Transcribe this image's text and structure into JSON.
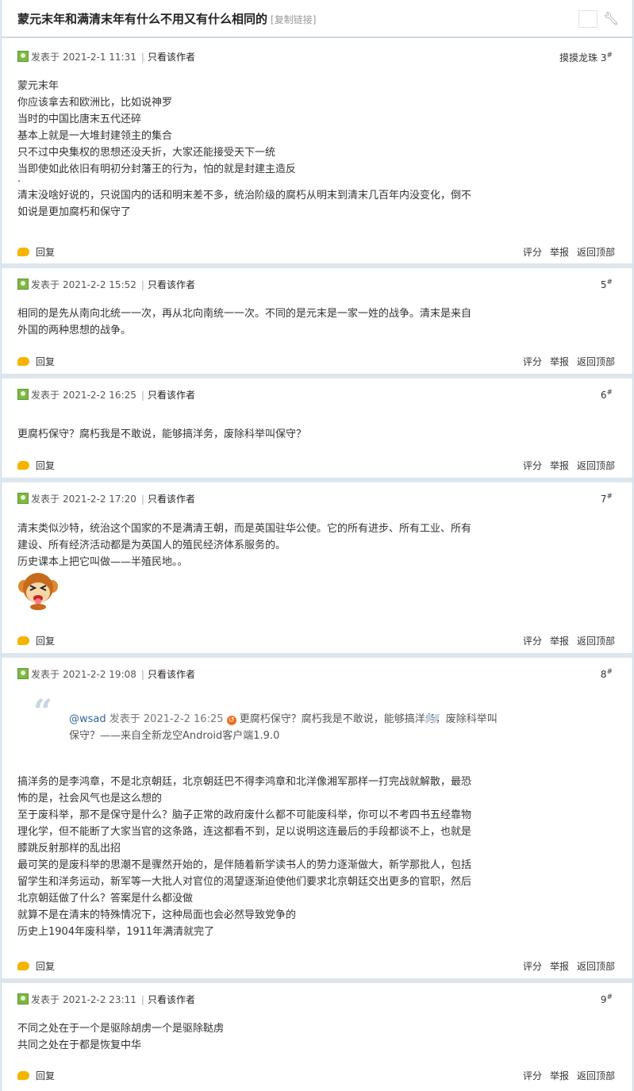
{
  "thread": {
    "title": "蒙元末年和满清末年有什么不用又有什么相同的",
    "copy_link": "[复制链接]"
  },
  "labels": {
    "posted_at": "发表于",
    "author_only": "只看该作者",
    "reply": "回复",
    "rate": "评分",
    "report": "举报",
    "back_top": "返回顶部",
    "floor_mark": "#"
  },
  "posts": [
    {
      "date": "2021-2-1 11:31",
      "floor": "摸摸龙珠 3",
      "lines": [
        "蒙元末年",
        "你应该拿去和欧洲比，比如说神罗",
        "当时的中国比唐末五代还碎",
        "基本上就是一大堆封建领主的集合",
        "只不过中央集权的思想还没夭折，大家还能接受天下一统",
        "当即使如此依旧有明初分封藩王的行为，怕的就是封建主造反",
        "·",
        "清末没啥好说的，只说国内的话和明末差不多，统治阶级的腐朽从明末到清末几百年内没变化，倒不",
        "如说是更加腐朽和保守了"
      ]
    },
    {
      "date": "2021-2-2 15:52",
      "floor": "5",
      "lines": [
        "相同的是先从南向北统一一次，再从北向南统一一次。不同的是元末是一家一姓的战争。清末是来自",
        "外国的两种思想的战争。"
      ]
    },
    {
      "date": "2021-2-2 16:25",
      "floor": "6",
      "lines": [
        "更腐朽保守？腐朽我是不敢说，能够搞洋务，废除科举叫保守？"
      ]
    },
    {
      "date": "2021-2-2 17:20",
      "floor": "7",
      "lines": [
        "清末类似沙特，统治这个国家的不是满清王朝，而是英国驻华公使。它的所有进步、所有工业、所有",
        "建设、所有经济活动都是为英国人的殖民经济体系服务的。",
        "历史课本上把它叫做——半殖民地。。"
      ],
      "emoji": "monkey-emoticon"
    },
    {
      "date": "2021-2-2 19:08",
      "floor": "8",
      "quote": {
        "user": "@wsad",
        "posted": "发表于 2021-2-2 16:25",
        "text_1": "更腐朽保守？腐朽我是不敢说，能够搞洋务，废除科举叫",
        "text_2": "保守？——来自全新龙空Android客户端1.9.0"
      },
      "lines": [
        "搞洋务的是李鸿章，不是北京朝廷，北京朝廷巴不得李鸿章和北洋像湘军那样一打完战就解散，最恐",
        "怖的是，社会风气也是这么想的",
        "至于废科举，那不是保守是什么？脑子正常的政府废什么都不可能废科举，你可以不考四书五经靠物",
        "理化学，但不能断了大家当官的这条路，连这都看不到，足以说明这连最后的手段都谈不上，也就是",
        "膝跳反射那样的乱出招",
        "最可笑的是废科举的思潮不是骤然开始的，是伴随着新学读书人的势力逐渐做大，新学那批人，包括",
        "留学生和洋务运动，新军等一大批人对官位的渴望逐渐迫使他们要求北京朝廷交出更多的官职，然后",
        "北京朝廷做了什么？答案是什么都没做",
        "就算不是在清末的特殊情况下，这种局面也会必然导致党争的",
        "历史上1904年废科举，1911年满清就完了"
      ]
    },
    {
      "date": "2021-2-2 23:11",
      "floor": "9",
      "lines": [
        "不同之处在于一个是驱除胡虏一个是驱除鞑虏",
        "共同之处在于都是恢复中华"
      ]
    }
  ]
}
